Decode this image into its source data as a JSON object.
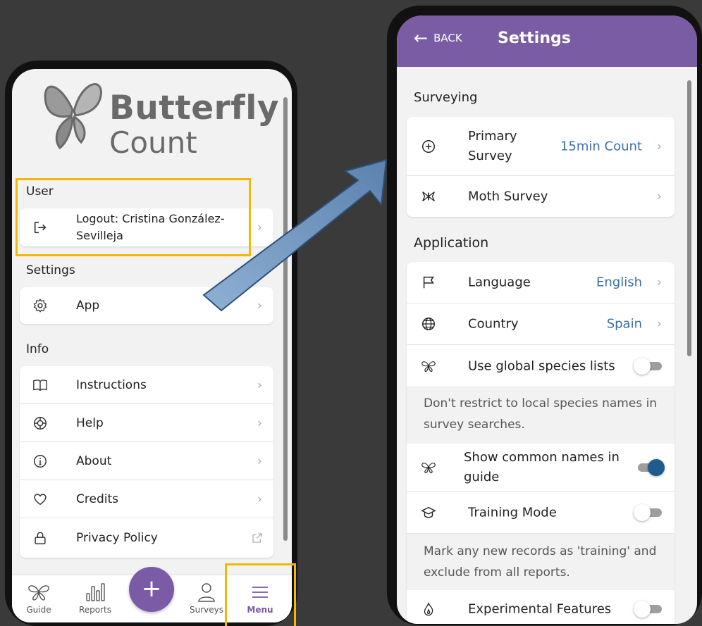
{
  "left": {
    "logo": {
      "word1": "Butterfly",
      "word2": "Count"
    },
    "user": {
      "heading": "User",
      "logout_label": "Logout: Cristina González-Sevilleja"
    },
    "settings": {
      "heading": "Settings",
      "items": [
        {
          "label": "App",
          "icon": "gear-icon"
        }
      ]
    },
    "info": {
      "heading": "Info",
      "items": [
        {
          "label": "Instructions",
          "icon": "book-icon"
        },
        {
          "label": "Help",
          "icon": "lifebuoy-icon"
        },
        {
          "label": "About",
          "icon": "info-icon"
        },
        {
          "label": "Credits",
          "icon": "heart-icon"
        },
        {
          "label": "Privacy Policy",
          "icon": "lock-icon"
        }
      ]
    },
    "tabbar": {
      "guide": "Guide",
      "reports": "Reports",
      "add": "+",
      "surveys": "Surveys",
      "menu": "Menu"
    }
  },
  "right": {
    "header": {
      "back": "BACK",
      "title": "Settings"
    },
    "surveying": {
      "heading": "Surveying",
      "primary_label": "Primary Survey",
      "primary_value": "15min Count",
      "moth_label": "Moth Survey"
    },
    "application": {
      "heading": "Application",
      "language_label": "Language",
      "language_value": "English",
      "country_label": "Country",
      "country_value": "Spain",
      "global_label": "Use global species lists",
      "global_on": false,
      "global_note": "Don't restrict to local species names in survey searches.",
      "common_label": "Show common names in guide",
      "common_on": true,
      "training_label": "Training Mode",
      "training_on": false,
      "training_note": "Mark any new records as 'training' and exclude from all reports.",
      "experimental_label": "Experimental Features",
      "experimental_on": false
    }
  },
  "colors": {
    "accent": "#7a5ca4",
    "link": "#3b6fa8",
    "highlight": "#f5b800",
    "toggle_on": "#1f5c8e"
  }
}
